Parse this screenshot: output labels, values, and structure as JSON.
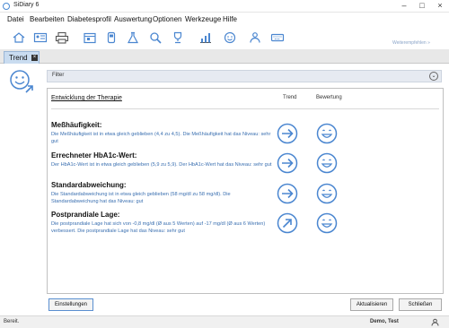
{
  "window": {
    "title": "SiDiary 6"
  },
  "menu": [
    {
      "label": "Datei"
    },
    {
      "label": "Bearbeiten"
    },
    {
      "label": "Diabetesprofil"
    },
    {
      "label": "Auswertung"
    },
    {
      "label": "Optionen"
    },
    {
      "label": "Werkzeuge"
    },
    {
      "label": "Hilfe"
    }
  ],
  "toolbar": {
    "icons": [
      "home-icon",
      "contact-card-icon",
      "print-icon",
      "calendar-icon",
      "device-icon",
      "lab-flask-icon",
      "search-icon",
      "trophy-icon",
      "chart-icon",
      "smiley-icon",
      "community-icon",
      "keyboard-icon"
    ],
    "right_label": "Weiterempfehlen »"
  },
  "tabs": [
    {
      "label": "Trend",
      "close": "×"
    }
  ],
  "filter": {
    "label": "Filter",
    "toggle": "⌄"
  },
  "panel": {
    "title": "Entwicklung der Therapie",
    "col_trend": "Trend",
    "col_rating": "Bewertung"
  },
  "metrics": [
    {
      "title": "Meßhäufigkeit:",
      "desc": "Die Meßhäufigkeit ist in etwa gleich geblieben (4,4 zu 4,5). Die Meßhäufigkeit hat das Niveau: sehr gut",
      "trend": "right",
      "rating": "happy"
    },
    {
      "title": "Errechneter HbA1c-Wert:",
      "desc": "Der HbA1c-Wert ist in etwa gleich geblieben (5,9 zu 5,9). Der HbA1c-Wert hat das Niveau: sehr gut",
      "trend": "right",
      "rating": "happy"
    },
    {
      "title": "Standardabweichung:",
      "desc": "Die Standardabweichung ist in etwa gleich geblieben (58 mg/dl zu 58 mg/dl). Die Standardabweichung hat das Niveau: gut",
      "trend": "right",
      "rating": "happy"
    },
    {
      "title": "Postprandiale Lage:",
      "desc": "Die postprandiale Lage hat sich von -0,8 mg/dl (Ø aus 5 Werten) auf -17 mg/dl (Ø aus 6 Werten) verbessert. Die postprandiale Lage hat das Niveau: sehr gut",
      "trend": "up-right",
      "rating": "happy"
    }
  ],
  "buttons": {
    "settings": "Einstellungen",
    "refresh": "Aktualisieren",
    "close": "Schließen"
  },
  "status": {
    "left": "Bereit.",
    "user": "Demo, Test"
  },
  "colors": {
    "accent": "#4a86d0",
    "text_blue": "#3a6fb0"
  }
}
